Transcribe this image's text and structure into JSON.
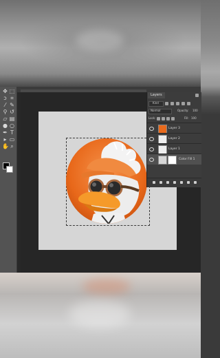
{
  "layers_panel": {
    "tab_label": "Layers",
    "filter_value": "Kind",
    "blend_mode": "Normal",
    "opacity_label": "Opacity:",
    "opacity_value": "100",
    "lock_label": "Lock:",
    "fill_label": "Fill:",
    "fill_value": "100",
    "layers": [
      {
        "name": "Layer 3",
        "thumbnail": "duck",
        "visible": true,
        "selected": false
      },
      {
        "name": "Layer 2",
        "thumbnail": "blank",
        "visible": true,
        "selected": false
      },
      {
        "name": "Layer 1",
        "thumbnail": "blank",
        "visible": true,
        "selected": false
      },
      {
        "name": "Color Fill 1",
        "thumbnail": "fill",
        "visible": true,
        "selected": true
      }
    ]
  },
  "canvas": {
    "background_color": "#d6d6d6",
    "subject_colors": {
      "orange": "#e96a1c",
      "white": "#f2f2f2"
    }
  },
  "toolbar": {
    "icons": [
      "move-icon",
      "marquee-icon",
      "lasso-icon",
      "crop-icon",
      "eyedropper-icon",
      "brush-icon",
      "stamp-icon",
      "history-brush-icon",
      "eraser-icon",
      "gradient-icon",
      "blur-icon",
      "dodge-icon",
      "pen-icon",
      "type-icon",
      "path-select-icon",
      "shape-icon",
      "hand-icon",
      "zoom-icon"
    ],
    "foreground_color": "#000000",
    "background_color": "#ffffff"
  }
}
